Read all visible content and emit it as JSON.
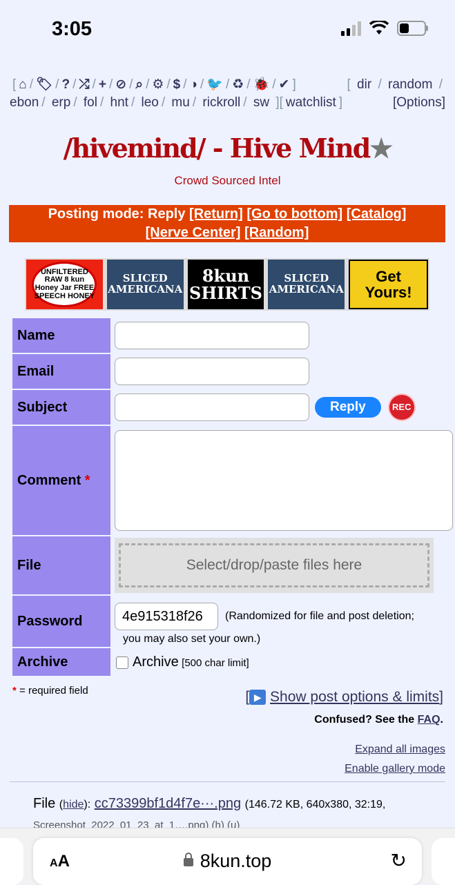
{
  "status_bar": {
    "time": "3:05",
    "battery_level": 0.35
  },
  "top_nav": {
    "icons": [
      "home-icon",
      "tags-icon",
      "help-icon",
      "shuffle-icon",
      "plus-icon",
      "ban-icon",
      "search-icon",
      "gear-icon",
      "dollar-icon",
      "contrast-icon",
      "twitter-icon",
      "recycle-icon",
      "bug-icon",
      "check-circle-icon"
    ],
    "icon_glyphs": [
      "⌂",
      "🏷",
      "?",
      "⤮",
      "+",
      "⊘",
      "⌕",
      "⚙",
      "$",
      "◑",
      "🐦",
      "♻",
      "🐞",
      "✔"
    ],
    "links_a": [
      "dir",
      "random"
    ],
    "links_b": [
      "ebon",
      "erp",
      "fol",
      "hnt",
      "leo",
      "mu",
      "rickroll",
      "sw"
    ],
    "watchlist": "watchlist",
    "options": "[Options]"
  },
  "board": {
    "title": "/hivemind/ - Hive Mind",
    "star": "★",
    "subtitle": "Crowd Sourced Intel"
  },
  "posting_mode": {
    "label": "Posting mode: Reply",
    "return": "[Return]",
    "bottom": "[Go to bottom]",
    "catalog": "[Catalog]",
    "nerve": "[Nerve Center]",
    "random": "[Random]"
  },
  "banner": {
    "ad1": "UNFILTERED RAW 8 kun Honey Jar FREE SPEECH HONEY",
    "ad2": "SLICED AMERICANA",
    "ad3_line1": "8kun",
    "ad3_line2": "SHIRTS",
    "ad4": "SLICED AMERICANA",
    "ad5_line1": "Get",
    "ad5_line2": "Yours!"
  },
  "form": {
    "name_label": "Name",
    "email_label": "Email",
    "subject_label": "Subject",
    "reply_button": "Reply",
    "rec_button": "REC",
    "comment_label": "Comment",
    "required_star": "*",
    "file_label": "File",
    "dropzone_text": "Select/drop/paste files here",
    "password_label": "Password",
    "password_value": "4e915318f26",
    "password_note_1": "(Randomized for file and post deletion;",
    "password_note_2": "you may also set your own.)",
    "archive_label": "Archive",
    "archive_checkbox": "Archive",
    "archive_limit": "[500 char limit]"
  },
  "footer": {
    "required_text": "= required field",
    "show_options": "Show post options & limits",
    "confused": "Confused? See the",
    "faq": "FAQ",
    "expand": "Expand all images",
    "gallery": "Enable gallery mode"
  },
  "file_info": {
    "prefix": "File",
    "hide": "hide",
    "filename": "cc73399bf1d4f7e···.png",
    "meta": "(146.72 KB, 640x380, 32:19,",
    "original": "Screenshot_2022_01_23_at_1….png) (h) (u)"
  },
  "safari": {
    "aa_small": "A",
    "aa_big": "A",
    "url": "8kun.top"
  }
}
